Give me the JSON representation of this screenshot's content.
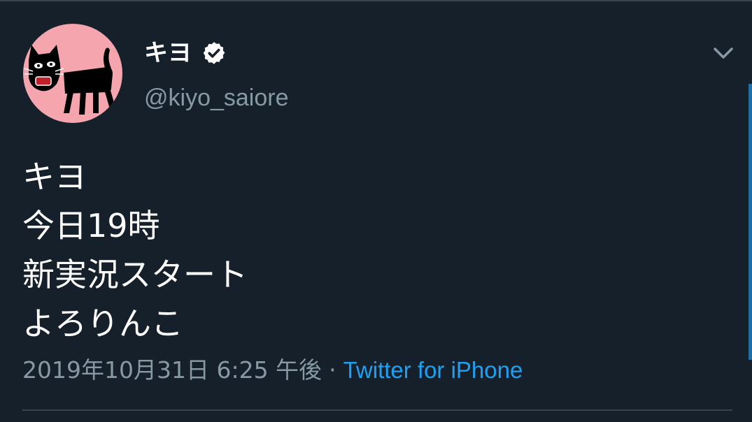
{
  "tweet": {
    "display_name": "キヨ",
    "handle": "@kiyo_saiore",
    "verified": true,
    "text_lines": [
      "キヨ",
      "今日19時",
      "新実況スタート",
      "よろりんこ"
    ],
    "timestamp": "2019年10月31日 6:25 午後",
    "separator": "·",
    "source": "Twitter for iPhone"
  },
  "icons": {
    "verified": "verified-badge-icon",
    "more": "chevron-down-icon",
    "avatar": "black-cat-drawing"
  },
  "colors": {
    "background": "#15202b",
    "primary_text": "#ffffff",
    "secondary_text": "#8899a6",
    "link": "#1da1f2",
    "avatar_bg": "#f5a5ad",
    "divider": "#38444d"
  }
}
